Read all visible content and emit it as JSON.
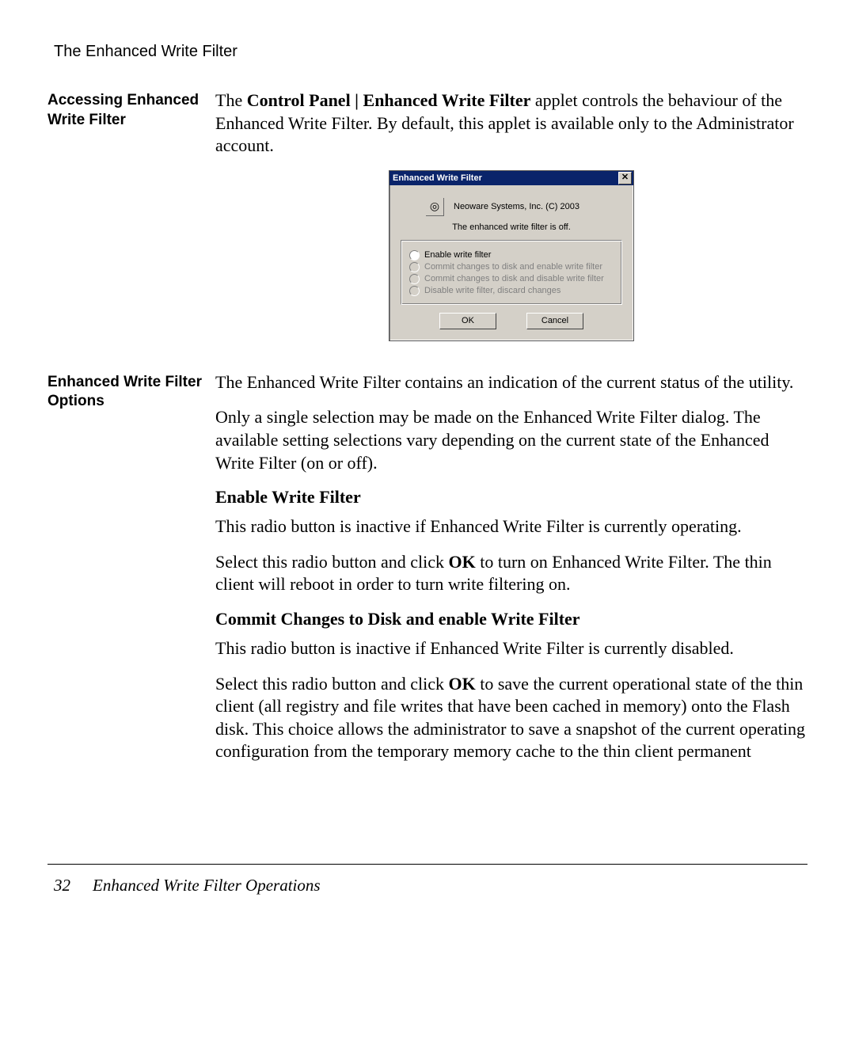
{
  "running_head": "The Enhanced Write Filter",
  "section1": {
    "heading": "Accessing Enhanced Write Filter",
    "para1_pre": "The ",
    "para1_bold": "Control Panel | Enhanced Write Filter",
    "para1_post": " applet controls the behaviour of the Enhanced Write Filter. By default, this applet is available only to the Administrator account."
  },
  "dialog": {
    "title": "Enhanced Write Filter",
    "close_glyph": "✕",
    "icon_glyph": "◎",
    "vendor": "Neoware Systems, Inc. (C) 2003",
    "status": "The enhanced write filter is off.",
    "options": {
      "o1": "Enable write filter",
      "o2": "Commit changes to disk and enable write filter",
      "o3": "Commit changes to disk and disable write filter",
      "o4": "Disable write filter, discard changes"
    },
    "buttons": {
      "ok": "OK",
      "cancel": "Cancel"
    }
  },
  "section2": {
    "heading": "Enhanced Write Filter Options",
    "p1": "The Enhanced Write Filter contains an indication of the current status of the utility.",
    "p2": "Only a single selection may be made on the Enhanced Write Filter dialog. The available setting selections vary depending on the current state of the Enhanced Write Filter (on or off).",
    "sub1": "Enable Write Filter",
    "p3": "This radio button is inactive if Enhanced Write Filter is currently operating.",
    "p4_pre": "Select this radio button and click ",
    "p4_bold": "OK",
    "p4_post": " to turn on Enhanced Write Filter. The thin client will reboot in order to turn write filtering on.",
    "sub2": "Commit Changes to Disk and enable Write Filter",
    "p5": "This radio button is inactive if Enhanced Write Filter is currently disabled.",
    "p6_pre": "Select this radio button and click ",
    "p6_bold": "OK",
    "p6_post": " to save the current operational state of the thin client (all registry and file writes that have been cached in memory) onto the Flash disk. This choice allows the administrator to save a snapshot of the current operating configuration from the temporary memory cache to the thin client permanent"
  },
  "footer": {
    "page_number": "32",
    "chapter": "Enhanced Write Filter Operations"
  }
}
